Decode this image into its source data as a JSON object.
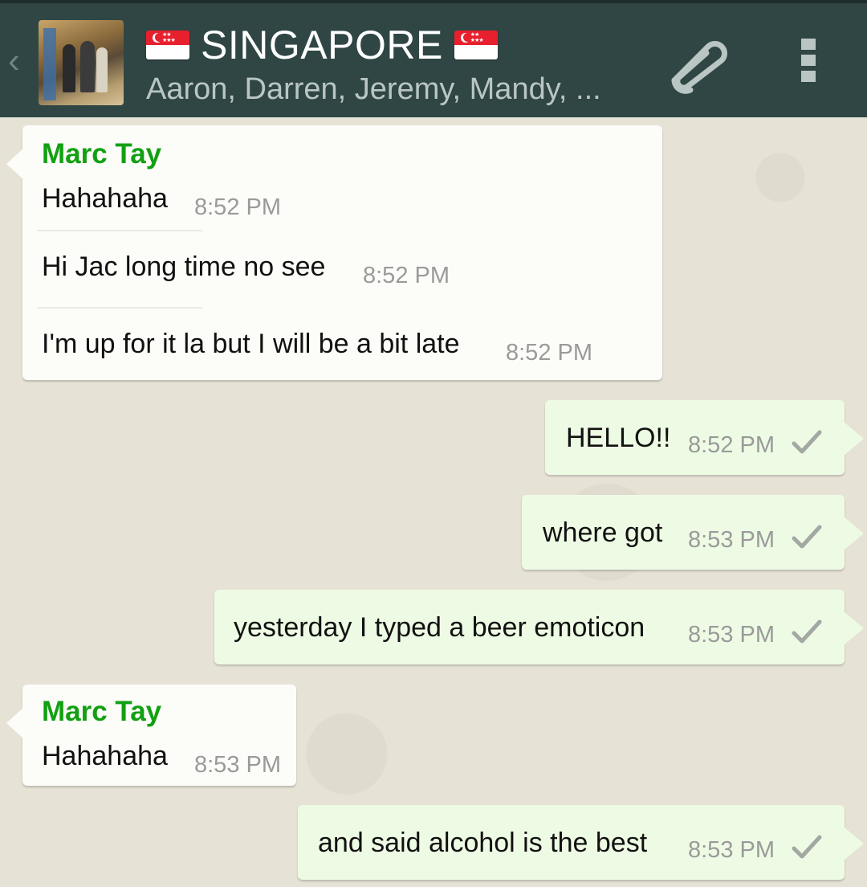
{
  "header": {
    "group_name": "SINGAPORE",
    "members": "Aaron, Darren, Jeremy, Mandy, ...",
    "icons": [
      "back-icon",
      "group-avatar",
      "sg-flag-icon",
      "attach-icon",
      "overflow-menu-icon"
    ]
  },
  "messages": [
    {
      "direction": "incoming",
      "sender": "Marc Tay",
      "lines": [
        {
          "text": "Hahahaha",
          "time": "8:52 PM"
        },
        {
          "text": "Hi Jac long time no see",
          "time": "8:52 PM"
        },
        {
          "text": "I'm up for it la but I will be a bit late",
          "time": "8:52 PM"
        }
      ]
    },
    {
      "direction": "outgoing",
      "text": "HELLO!!",
      "time": "8:52 PM",
      "status": "sent"
    },
    {
      "direction": "outgoing",
      "text": "where got",
      "time": "8:53 PM",
      "status": "sent"
    },
    {
      "direction": "outgoing",
      "text": "yesterday I typed a beer emoticon",
      "time": "8:53 PM",
      "status": "sent"
    },
    {
      "direction": "incoming",
      "sender": "Marc Tay",
      "lines": [
        {
          "text": "Hahahaha",
          "time": "8:53 PM"
        }
      ]
    },
    {
      "direction": "outgoing",
      "text": "and said alcohol is the best",
      "time": "8:53 PM",
      "status": "sent"
    }
  ],
  "colors": {
    "header_bg": "#2f4644",
    "sender_name": "#12a012",
    "incoming_bubble": "#fcfcf8",
    "outgoing_bubble": "#eefbe4",
    "timestamp": "#9a9a9a"
  }
}
